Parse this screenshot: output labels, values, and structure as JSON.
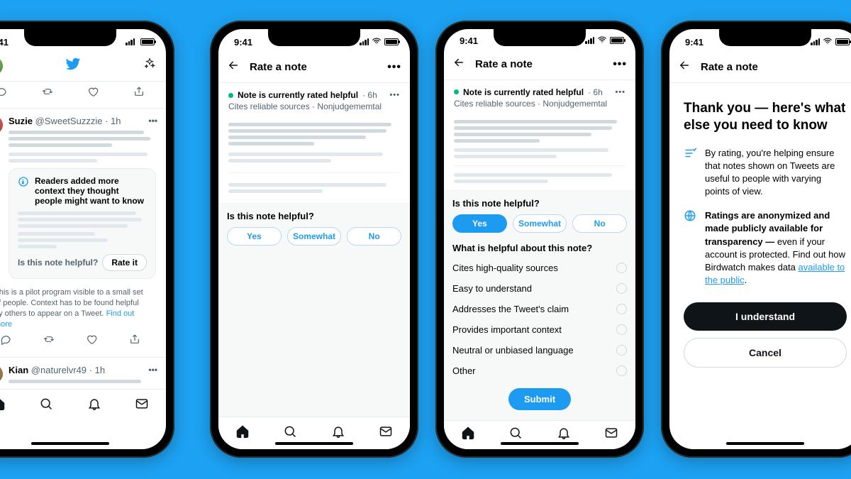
{
  "status": {
    "time": "9:41"
  },
  "page_title": "Rate a note",
  "note": {
    "status_text": "Note is currently rated helpful",
    "age": "6h",
    "subline": "Cites reliable sources · Nonjudgememtal"
  },
  "question": {
    "helpful_q": "Is this note helpful?",
    "options": {
      "yes": "Yes",
      "somewhat": "Somewhat",
      "no": "No"
    },
    "helpful_about_q": "What is helpful about this note?",
    "reasons": [
      "Cites high-quality sources",
      "Easy to understand",
      "Addresses the Tweet's claim",
      "Provides important context",
      "Neutral or unbiased language",
      "Other"
    ],
    "submit": "Submit"
  },
  "timeline": {
    "tweet1": {
      "name": "Suzie",
      "handle": "@SweetSuzzzie",
      "age": "1h"
    },
    "tweet2": {
      "name": "Kian",
      "handle": "@naturelvr49",
      "age": "1h"
    },
    "note_card": {
      "headline": "Readers added more context they thought people might want to know",
      "question": "Is this note helpful?",
      "rate": "Rate it"
    },
    "pilot_text": "This is a pilot program visible to a small set of people. Context has to be found helpful by others to appear on a Tweet.",
    "pilot_link": "Find out more"
  },
  "thankyou": {
    "heading": "Thank you — here's what else you need to know",
    "p1": "By rating, you're helping ensure that notes shown on Tweets are useful to people with varying points of view.",
    "p2_bold": "Ratings are anonymized and made publicly available for transparency —",
    "p2_rest": " even if your account is protected. Find out how Birdwatch makes data ",
    "p2_link": "available to the public",
    "primary": "I understand",
    "secondary": "Cancel"
  }
}
